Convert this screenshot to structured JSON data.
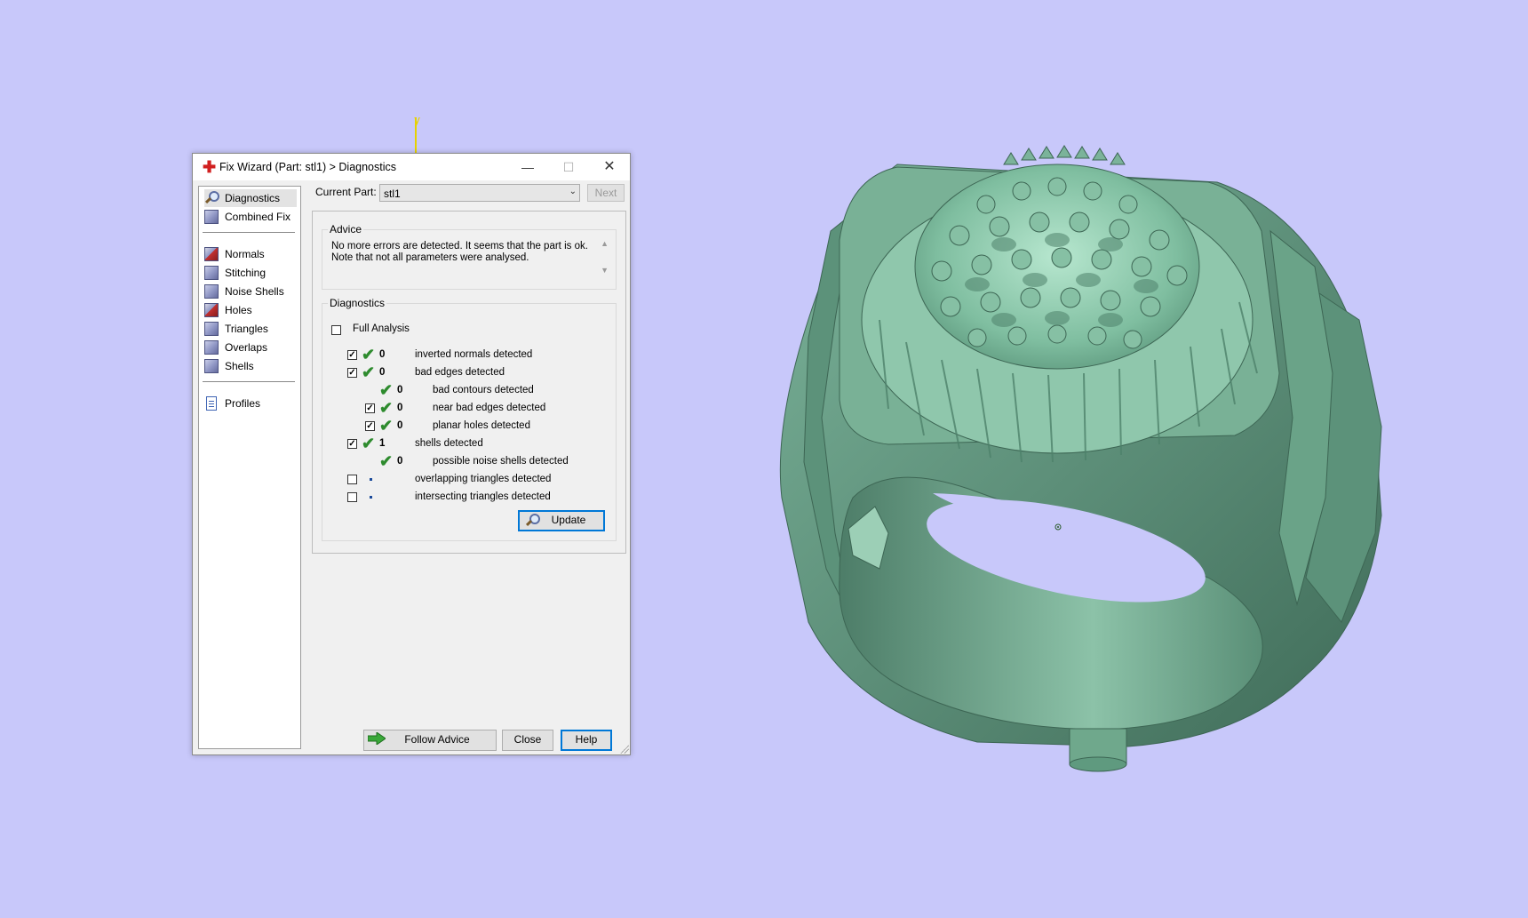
{
  "viewport": {
    "axis_label": "y",
    "background": "#c8c8fa",
    "model_color": "#6fa88c"
  },
  "window": {
    "title": "Fix Wizard (Part: stl1) > Diagnostics",
    "title_icon": "red-cross-icon",
    "minimize_glyph": "—",
    "maximize_glyph": "☐",
    "close_glyph": "✕"
  },
  "nav": {
    "group1": [
      {
        "label": "Diagnostics",
        "icon": "magnifier-icon",
        "selected": true
      },
      {
        "label": "Combined Fix",
        "icon": "cube-icon"
      }
    ],
    "group2": [
      {
        "label": "Normals",
        "icon": "normals-cube-icon"
      },
      {
        "label": "Stitching",
        "icon": "stitching-cube-icon"
      },
      {
        "label": "Noise Shells",
        "icon": "noise-shells-icon"
      },
      {
        "label": "Holes",
        "icon": "holes-cube-icon"
      },
      {
        "label": "Triangles",
        "icon": "triangles-cube-icon"
      },
      {
        "label": "Overlaps",
        "icon": "overlaps-cube-icon"
      },
      {
        "label": "Shells",
        "icon": "shells-cube-icon"
      }
    ],
    "group3": [
      {
        "label": "Profiles",
        "icon": "document-icon"
      }
    ]
  },
  "part": {
    "label": "Current Part:",
    "value": "stl1",
    "next_label": "Next"
  },
  "advice": {
    "title": "Advice",
    "text": "No more errors are detected. It seems that the part is ok.\nNote that not all parameters were analysed."
  },
  "diagnostics": {
    "title": "Diagnostics",
    "full_analysis_label": "Full Analysis",
    "full_analysis_checked": false,
    "rows": [
      {
        "checked": true,
        "status": "ok",
        "count": "0",
        "label": "inverted normals detected",
        "indent": 0
      },
      {
        "checked": true,
        "status": "ok",
        "count": "0",
        "label": "bad edges detected",
        "indent": 0
      },
      {
        "checked": null,
        "status": "ok",
        "count": "0",
        "label": "bad contours detected",
        "indent": 1
      },
      {
        "checked": true,
        "status": "ok",
        "count": "0",
        "label": "near bad edges detected",
        "indent": 1
      },
      {
        "checked": true,
        "status": "ok",
        "count": "0",
        "label": "planar holes detected",
        "indent": 1
      },
      {
        "checked": true,
        "status": "ok",
        "count": "1",
        "label": "shells detected",
        "indent": 0
      },
      {
        "checked": null,
        "status": "ok",
        "count": "0",
        "label": "possible noise shells detected",
        "indent": 1
      },
      {
        "checked": false,
        "status": "none",
        "count": "",
        "label": "overlapping triangles detected",
        "indent": 0
      },
      {
        "checked": false,
        "status": "none",
        "count": "",
        "label": "intersecting triangles detected",
        "indent": 0
      }
    ],
    "update_label": "Update"
  },
  "footer": {
    "follow_label": "Follow Advice",
    "close_label": "Close",
    "help_label": "Help"
  }
}
